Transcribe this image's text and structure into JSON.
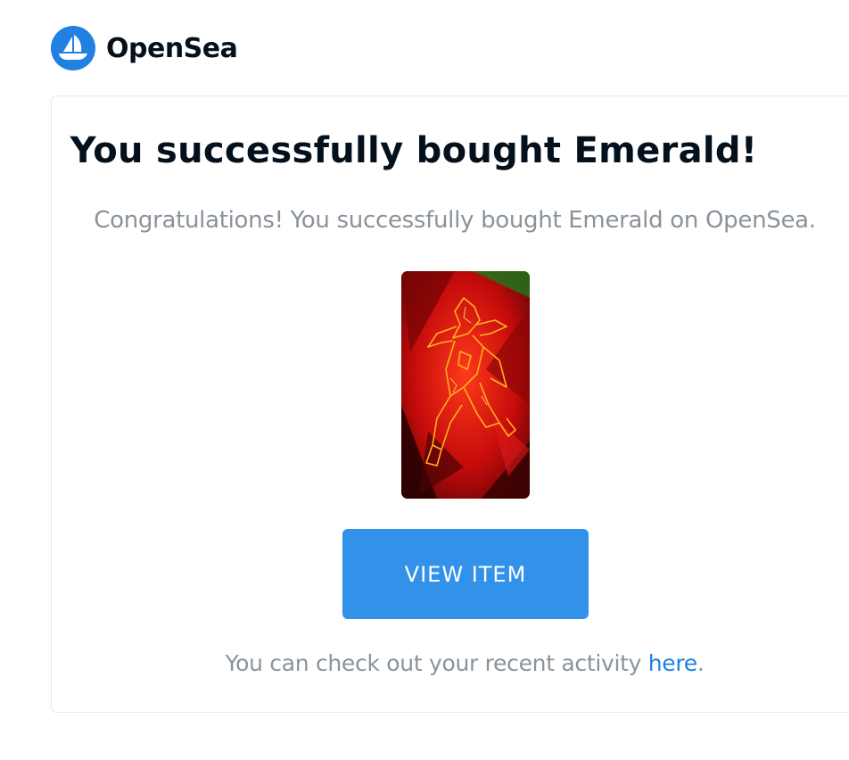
{
  "brand": {
    "name": "OpenSea",
    "logo_icon": "opensea-boat-icon",
    "color": "#2081e2"
  },
  "email": {
    "headline": "You successfully bought Emerald!",
    "subline": "Congratulations! You successfully bought Emerald on OpenSea.",
    "item_image_icon": "nft-artwork-image",
    "button_label": "VIEW ITEM",
    "button_color": "#3291e9",
    "footer_prefix": "You can check out your recent activity ",
    "footer_link": "here",
    "footer_suffix": "."
  }
}
